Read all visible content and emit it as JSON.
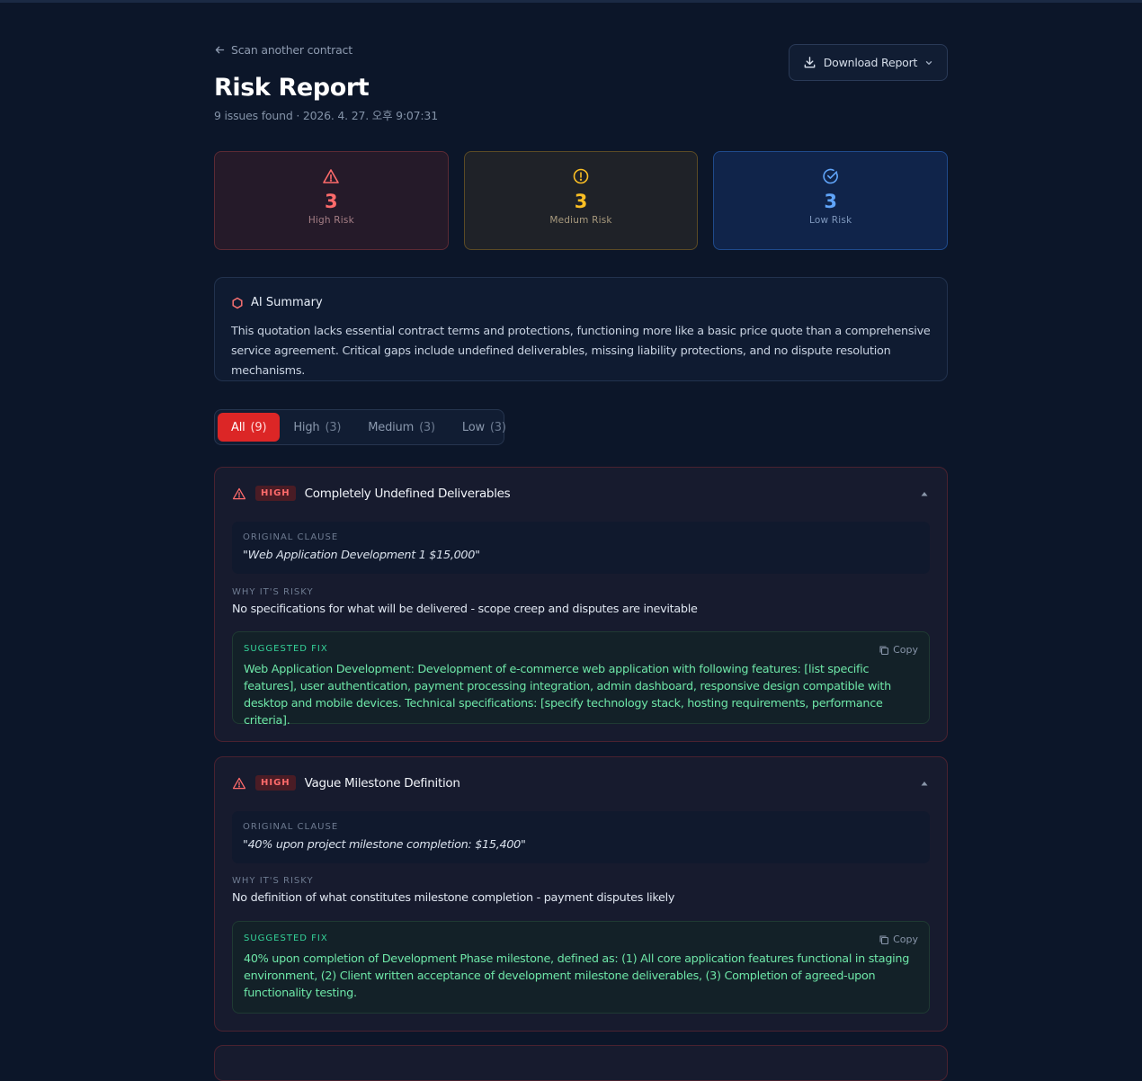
{
  "header": {
    "back_label": "Scan another contract",
    "title": "Risk Report",
    "subtitle": "9 issues found · 2026. 4. 27. 오후 9:07:31",
    "download_label": "Download Report"
  },
  "stats": {
    "high": {
      "count": "3",
      "label": "High Risk"
    },
    "medium": {
      "count": "3",
      "label": "Medium Risk"
    },
    "low": {
      "count": "3",
      "label": "Low Risk"
    }
  },
  "summary": {
    "heading": "AI Summary",
    "text": "This quotation lacks essential contract terms and protections, functioning more like a basic price quote than a comprehensive service agreement. Critical gaps include undefined deliverables, missing liability protections, and no dispute resolution mechanisms."
  },
  "tabs": [
    {
      "label": "All",
      "count": "(9)"
    },
    {
      "label": "High",
      "count": "(3)"
    },
    {
      "label": "Medium",
      "count": "(3)"
    },
    {
      "label": "Low",
      "count": "(3)"
    }
  ],
  "labels": {
    "original_clause": "ORIGINAL CLAUSE",
    "why_risky": "WHY IT'S RISKY",
    "suggested_fix": "SUGGESTED FIX",
    "copy": "Copy"
  },
  "issues": [
    {
      "severity": "HIGH",
      "title": "Completely Undefined Deliverables",
      "clause": "\"Web Application Development 1 $15,000\"",
      "why": "No specifications for what will be delivered - scope creep and disputes are inevitable",
      "fix": "Web Application Development: Development of e-commerce web application with following features: [list specific features], user authentication, payment processing integration, admin dashboard, responsive design compatible with desktop and mobile devices. Technical specifications: [specify technology stack, hosting requirements, performance criteria]."
    },
    {
      "severity": "HIGH",
      "title": "Vague Milestone Definition",
      "clause": "\"40% upon project milestone completion: $15,400\"",
      "why": "No definition of what constitutes milestone completion - payment disputes likely",
      "fix": "40% upon completion of Development Phase milestone, defined as: (1) All core application features functional in staging environment, (2) Client written acceptance of development milestone deliverables, (3) Completion of agreed-upon functionality testing."
    }
  ],
  "colors": {
    "background": "#0c1629",
    "high": "#ff6b6b",
    "medium": "#fbbf24",
    "low": "#60a5fa",
    "active_tab": "#dc2626",
    "fix_text": "#6ee7a8"
  }
}
